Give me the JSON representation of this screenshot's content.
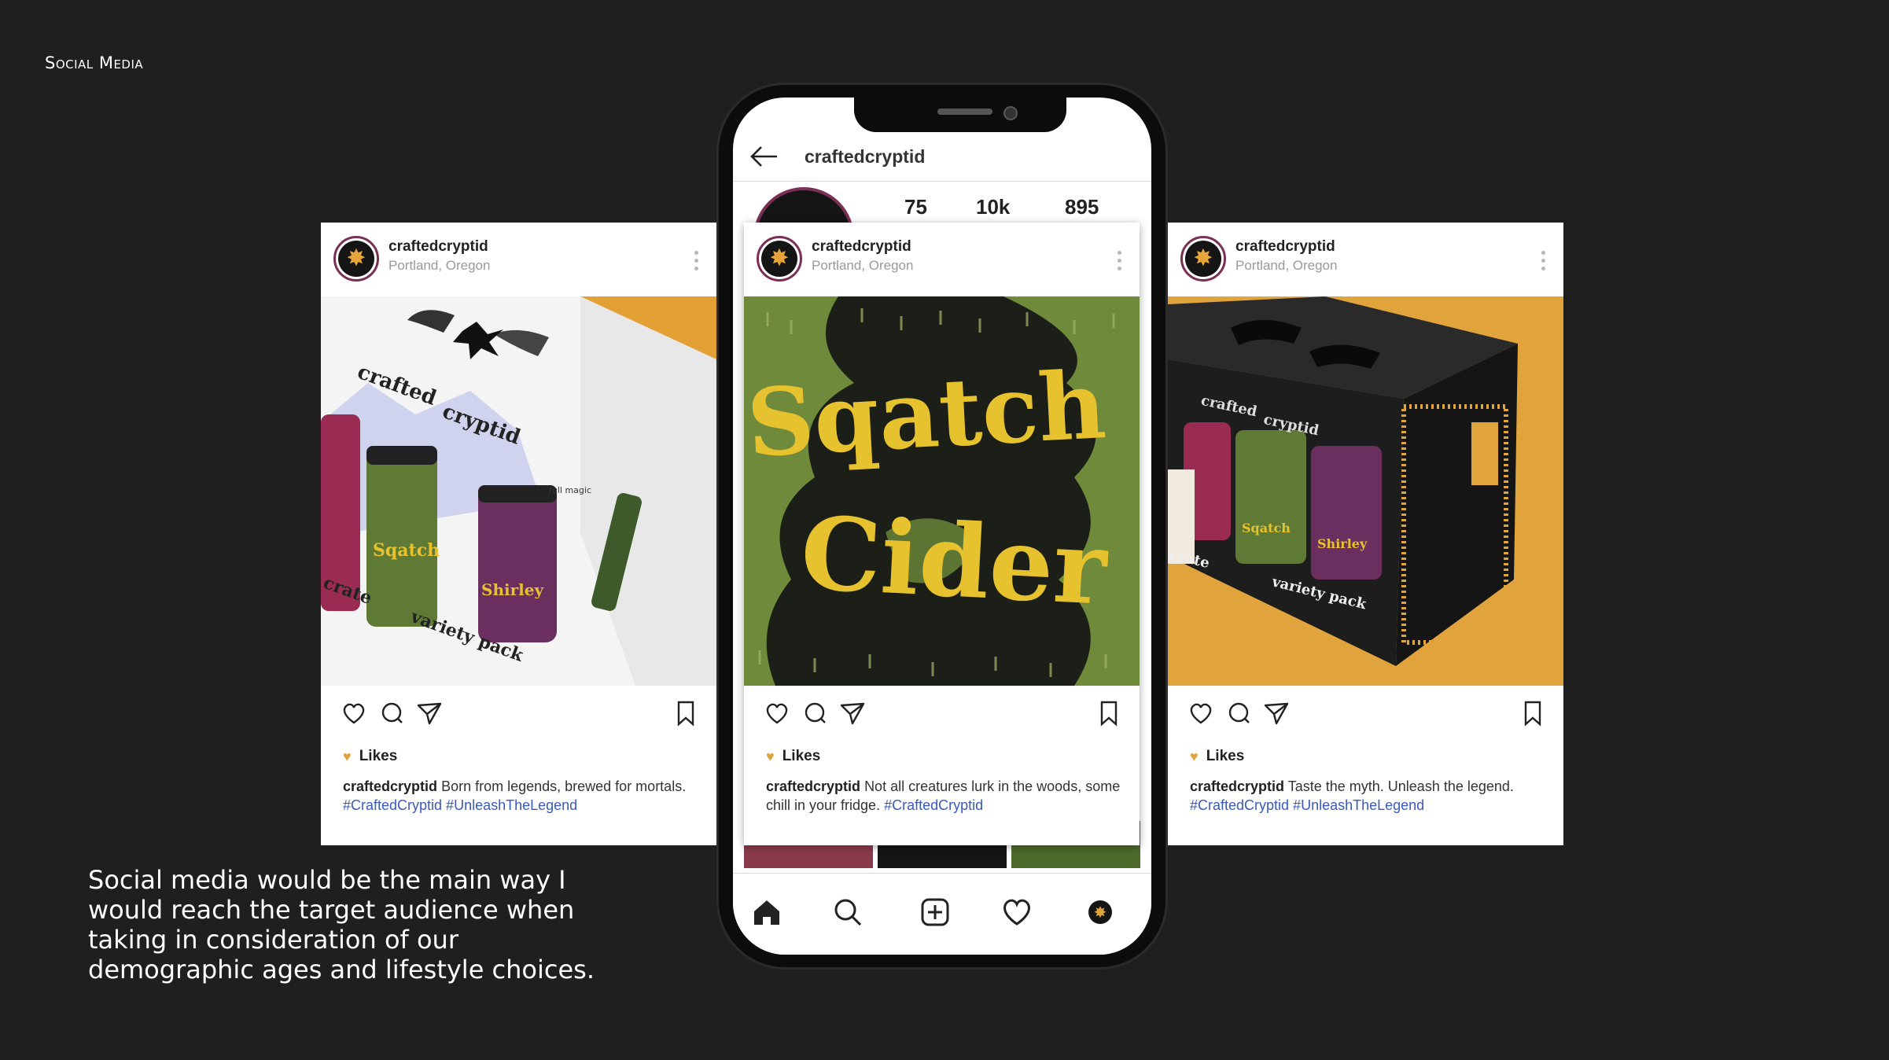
{
  "page": {
    "heading": "Social Media",
    "description": "Social media would be the main way I would reach the target audience when taking in consideration of our demographic ages and lifestyle choices."
  },
  "phone": {
    "username": "craftedcryptid",
    "stats": [
      "75",
      "10k",
      "895"
    ]
  },
  "posts": [
    {
      "username": "craftedcryptid",
      "location": "Portland, Oregon",
      "likes_label": "Likes",
      "caption_user": "craftedcryptid",
      "caption_text": "Born from legends, brewed for mortals.",
      "caption_tags": "#CraftedCryptid #UnleashTheLegend",
      "photo_text": [
        "crafted",
        "cryptid",
        "crate",
        "variety pack",
        "Sqatch Cider",
        "Shirley Devil",
        "full magic"
      ]
    },
    {
      "username": "craftedcryptid",
      "location": "Portland, Oregon",
      "likes_label": "Likes",
      "caption_user": "craftedcryptid",
      "caption_text": "Not all creatures lurk in the woods, some chill in your fridge.",
      "caption_tags": "#CraftedCryptid",
      "photo_text": [
        "Sqatch",
        "Cider"
      ]
    },
    {
      "username": "craftedcryptid",
      "location": "Portland, Oregon",
      "likes_label": "Likes",
      "caption_user": "craftedcryptid",
      "caption_text": "Taste the myth. Unleash the legend.",
      "caption_tags": "#CraftedCryptid #UnleashTheLegend",
      "photo_text": [
        "crafted",
        "cryptid",
        "crate",
        "variety pack",
        "Sqatch Cider",
        "Shirley Devil"
      ]
    }
  ],
  "icons": {
    "post_actions": [
      "heart-icon",
      "comment-icon",
      "share-icon",
      "bookmark-icon"
    ],
    "bottom_nav": [
      "home-icon",
      "search-icon",
      "add-post-icon",
      "activity-heart-icon",
      "profile-avatar-icon"
    ]
  },
  "colors": {
    "background": "#1f1f1f",
    "accent_orange": "#e1a33b",
    "hashtag_blue": "#3a5ab7",
    "avatar_ring": "#7a2f55",
    "cider_yellow": "#e6c22e",
    "cider_green": "#6f8a3b"
  }
}
